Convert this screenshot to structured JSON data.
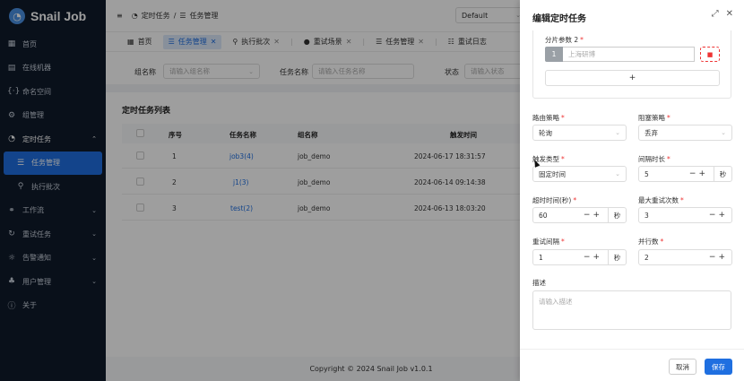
{
  "app": {
    "logo_text": "Snail Job"
  },
  "sidebar": {
    "items": [
      {
        "label": "首页",
        "icon": "grid-icon"
      },
      {
        "label": "在线机器",
        "icon": "server-icon"
      },
      {
        "label": "命名空间",
        "icon": "braces-icon"
      },
      {
        "label": "组管理",
        "icon": "cog-icon"
      },
      {
        "label": "定时任务",
        "icon": "clock-icon"
      },
      {
        "label": "任务管理",
        "icon": "task-list-icon"
      },
      {
        "label": "执行批次",
        "icon": "batch-icon"
      },
      {
        "label": "工作流",
        "icon": "workflow-icon"
      },
      {
        "label": "重试任务",
        "icon": "retry-icon"
      },
      {
        "label": "告警通知",
        "icon": "bell-icon"
      },
      {
        "label": "用户管理",
        "icon": "users-icon"
      },
      {
        "label": "关于",
        "icon": "info-icon"
      }
    ]
  },
  "header": {
    "menu_icon": "≡",
    "breadcrumb": [
      "定时任务",
      "任务管理"
    ],
    "theme_value": "Default"
  },
  "tabs": [
    {
      "label": "首页"
    },
    {
      "label": "任务管理"
    },
    {
      "label": "执行批次"
    },
    {
      "label": "重试场景"
    },
    {
      "label": "任务管理"
    },
    {
      "label": "重试日志"
    }
  ],
  "filter": {
    "group_label": "组名称",
    "group_placeholder": "请输入组名称",
    "task_label": "任务名称",
    "task_placeholder": "请输入任务名称",
    "status_label": "状态",
    "status_placeholder": "请输入状态"
  },
  "list": {
    "title": "定时任务列表",
    "columns": [
      "序号",
      "任务名称",
      "组名称",
      "触发时间"
    ],
    "rows": [
      {
        "idx": "1",
        "name": "job3(4)",
        "group": "job_demo",
        "time": "2024-06-17 18:31:57"
      },
      {
        "idx": "2",
        "name": "j1(3)",
        "group": "job_demo",
        "time": "2024-06-14 09:14:38"
      },
      {
        "idx": "3",
        "name": "test(2)",
        "group": "job_demo",
        "time": "2024-06-13 18:03:20"
      }
    ]
  },
  "footer": {
    "copyright": "Copyright © 2024 Snail Job v1.0.1"
  },
  "drawer": {
    "title": "编辑定时任务",
    "shard_label": "分片参数 2",
    "shard_index": "1",
    "shard_value": "上海研博",
    "add_symbol": "+",
    "route_label": "路由策略",
    "route_value": "轮询",
    "block_label": "阻塞策略",
    "block_value": "丢弃",
    "trigger_label": "触发类型",
    "trigger_value": "固定时间",
    "interval_label": "间隔时长",
    "interval_value": "5",
    "interval_unit": "秒",
    "timeout_label": "超时时间(秒)",
    "timeout_value": "60",
    "timeout_unit": "秒",
    "max_retry_label": "最大重试次数",
    "max_retry_value": "3",
    "retry_interval_label": "重试间隔",
    "retry_interval_value": "1",
    "retry_interval_unit": "秒",
    "parallel_label": "并行数",
    "parallel_value": "2",
    "desc_label": "描述",
    "desc_placeholder": "请输入描述",
    "cancel_label": "取消",
    "save_label": "保存"
  }
}
